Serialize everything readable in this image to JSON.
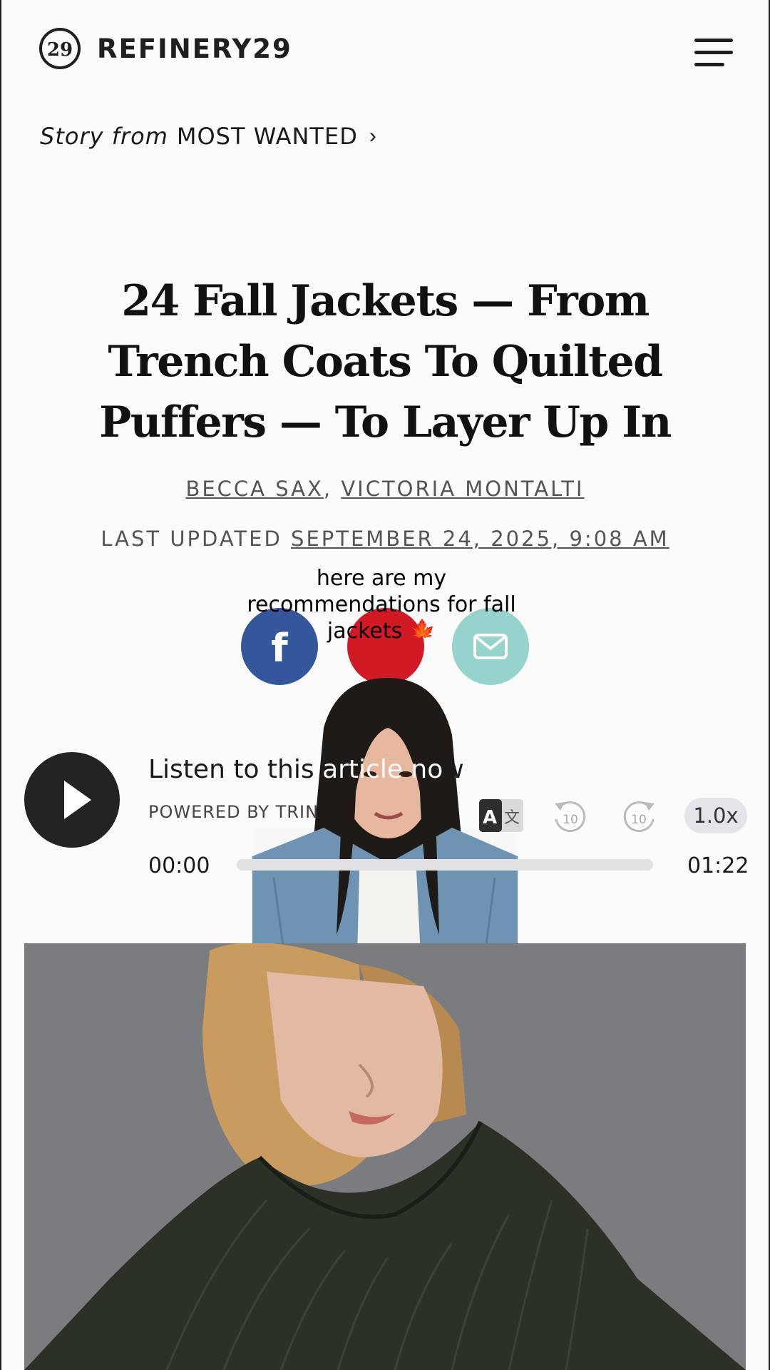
{
  "header": {
    "brand": "REFINERY29",
    "logo_mark": "29"
  },
  "story_from": {
    "prefix": "Story from",
    "name": "MOST WANTED",
    "chevron": "›"
  },
  "article": {
    "headline_lines": [
      "24 Fall Jackets — From",
      "Trench Coats To Quilted",
      "Puffers — To Layer Up In"
    ],
    "authors": [
      "BECCA SAX",
      "VICTORIA MONTALTI"
    ],
    "author_separator": ",",
    "updated_label": "LAST UPDATED",
    "updated_date": "SEPTEMBER 24, 2025, 9:08 AM"
  },
  "share": {
    "facebook_glyph": "f",
    "colors": {
      "facebook": "#33579a",
      "pinterest": "#d11a24",
      "email": "#96d3cc"
    }
  },
  "caption": {
    "lines": [
      "here are my",
      "recommendations for fall",
      "jackets 🍁"
    ]
  },
  "audio": {
    "title_visible": "Listen to this",
    "title_end": "w",
    "powered_by": "POWERED BY  TRIN",
    "speed": "1.0x",
    "rewind_label": "10",
    "forward_label": "10",
    "current_time": "00:00",
    "total_time": "01:22",
    "progress": 0
  },
  "icons": {
    "menu": "hamburger-menu-icon",
    "play": "play-icon",
    "translate": "translate-icon",
    "rewind": "rewind-10-icon",
    "forward": "forward-10-icon",
    "email": "envelope-icon"
  }
}
